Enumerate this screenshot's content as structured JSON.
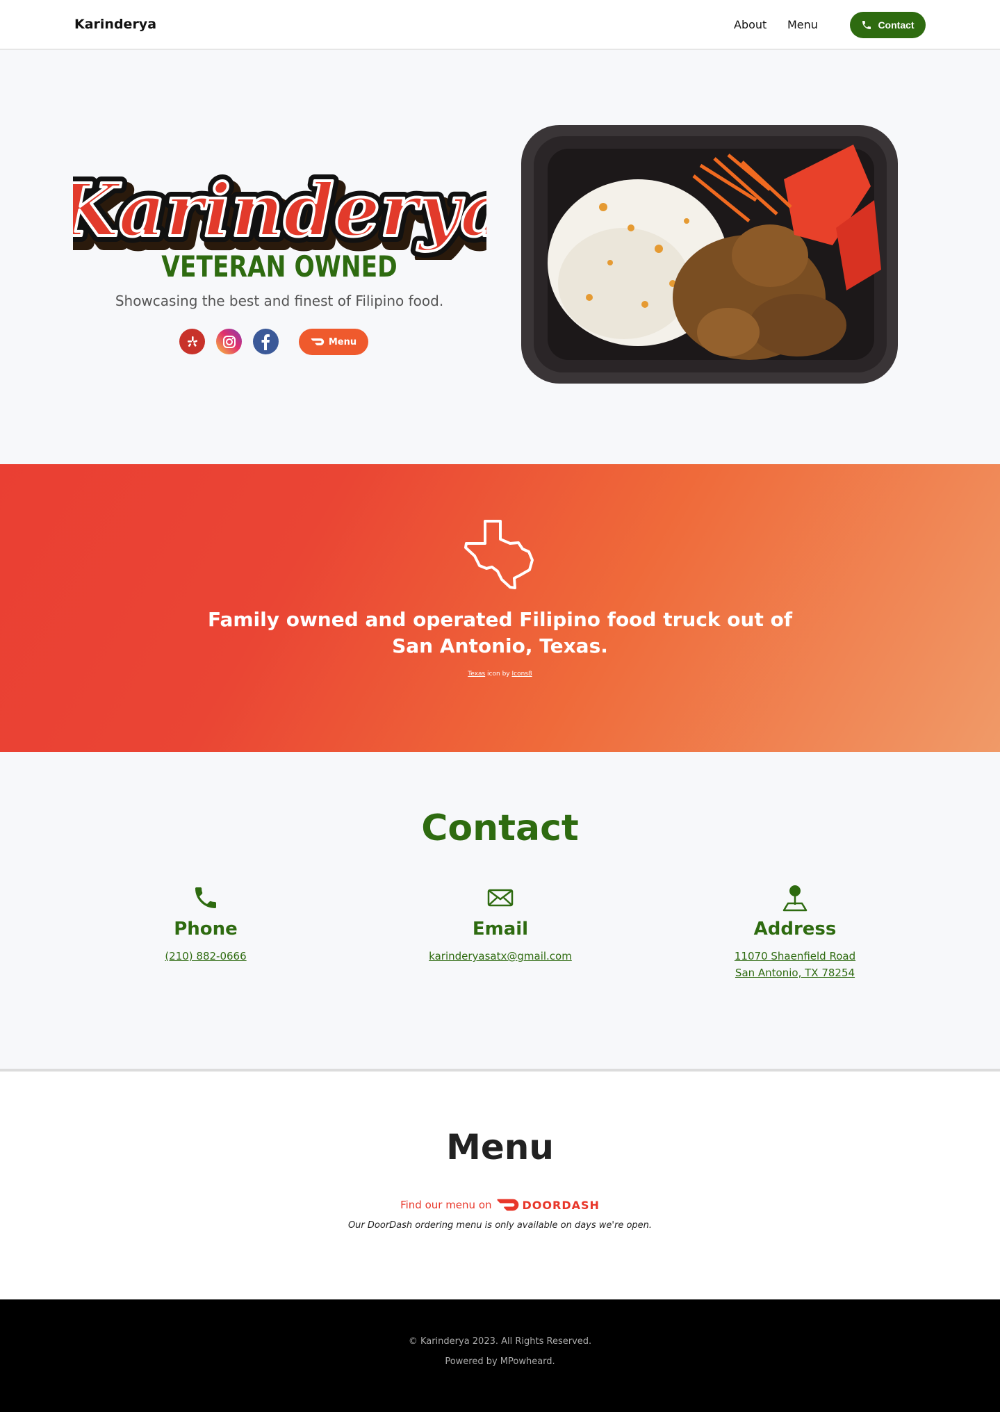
{
  "nav": {
    "brand": "Karinderya",
    "links": [
      "About",
      "Menu"
    ],
    "contact_button": "Contact"
  },
  "hero": {
    "logo_text": "Karinderya",
    "badge": "VETERAN OWNED",
    "tagline": "Showcasing the best and finest of Filipino food.",
    "menu_button": "Menu",
    "social_icons": [
      "yelp-icon",
      "instagram-icon",
      "facebook-icon"
    ]
  },
  "band": {
    "line1": "Family owned and operated Filipino food truck out of",
    "line2": "San Antonio, Texas.",
    "credit_link1": "Texas",
    "credit_mid": "icon by",
    "credit_link2": "Icons8"
  },
  "contact": {
    "title": "Contact",
    "phone": {
      "label": "Phone",
      "value": "(210) 882-0666"
    },
    "email": {
      "label": "Email",
      "value": "karinderyasatx@gmail.com"
    },
    "address": {
      "label": "Address",
      "line1": "11070 Shaenfield Road",
      "line2": "San Antonio, TX 78254"
    }
  },
  "menu": {
    "title": "Menu",
    "find_text": "Find our menu on",
    "doordash": "DOORDASH",
    "note": "Our DoorDash ordering menu is only available on days we're open."
  },
  "footer": {
    "copyright": "© Karinderya 2023. All Rights Reserved.",
    "powered": "Powered by MPowheard."
  },
  "colors": {
    "green": "#2e6b10",
    "orange": "#ef5a2d",
    "red": "#e8372a"
  }
}
